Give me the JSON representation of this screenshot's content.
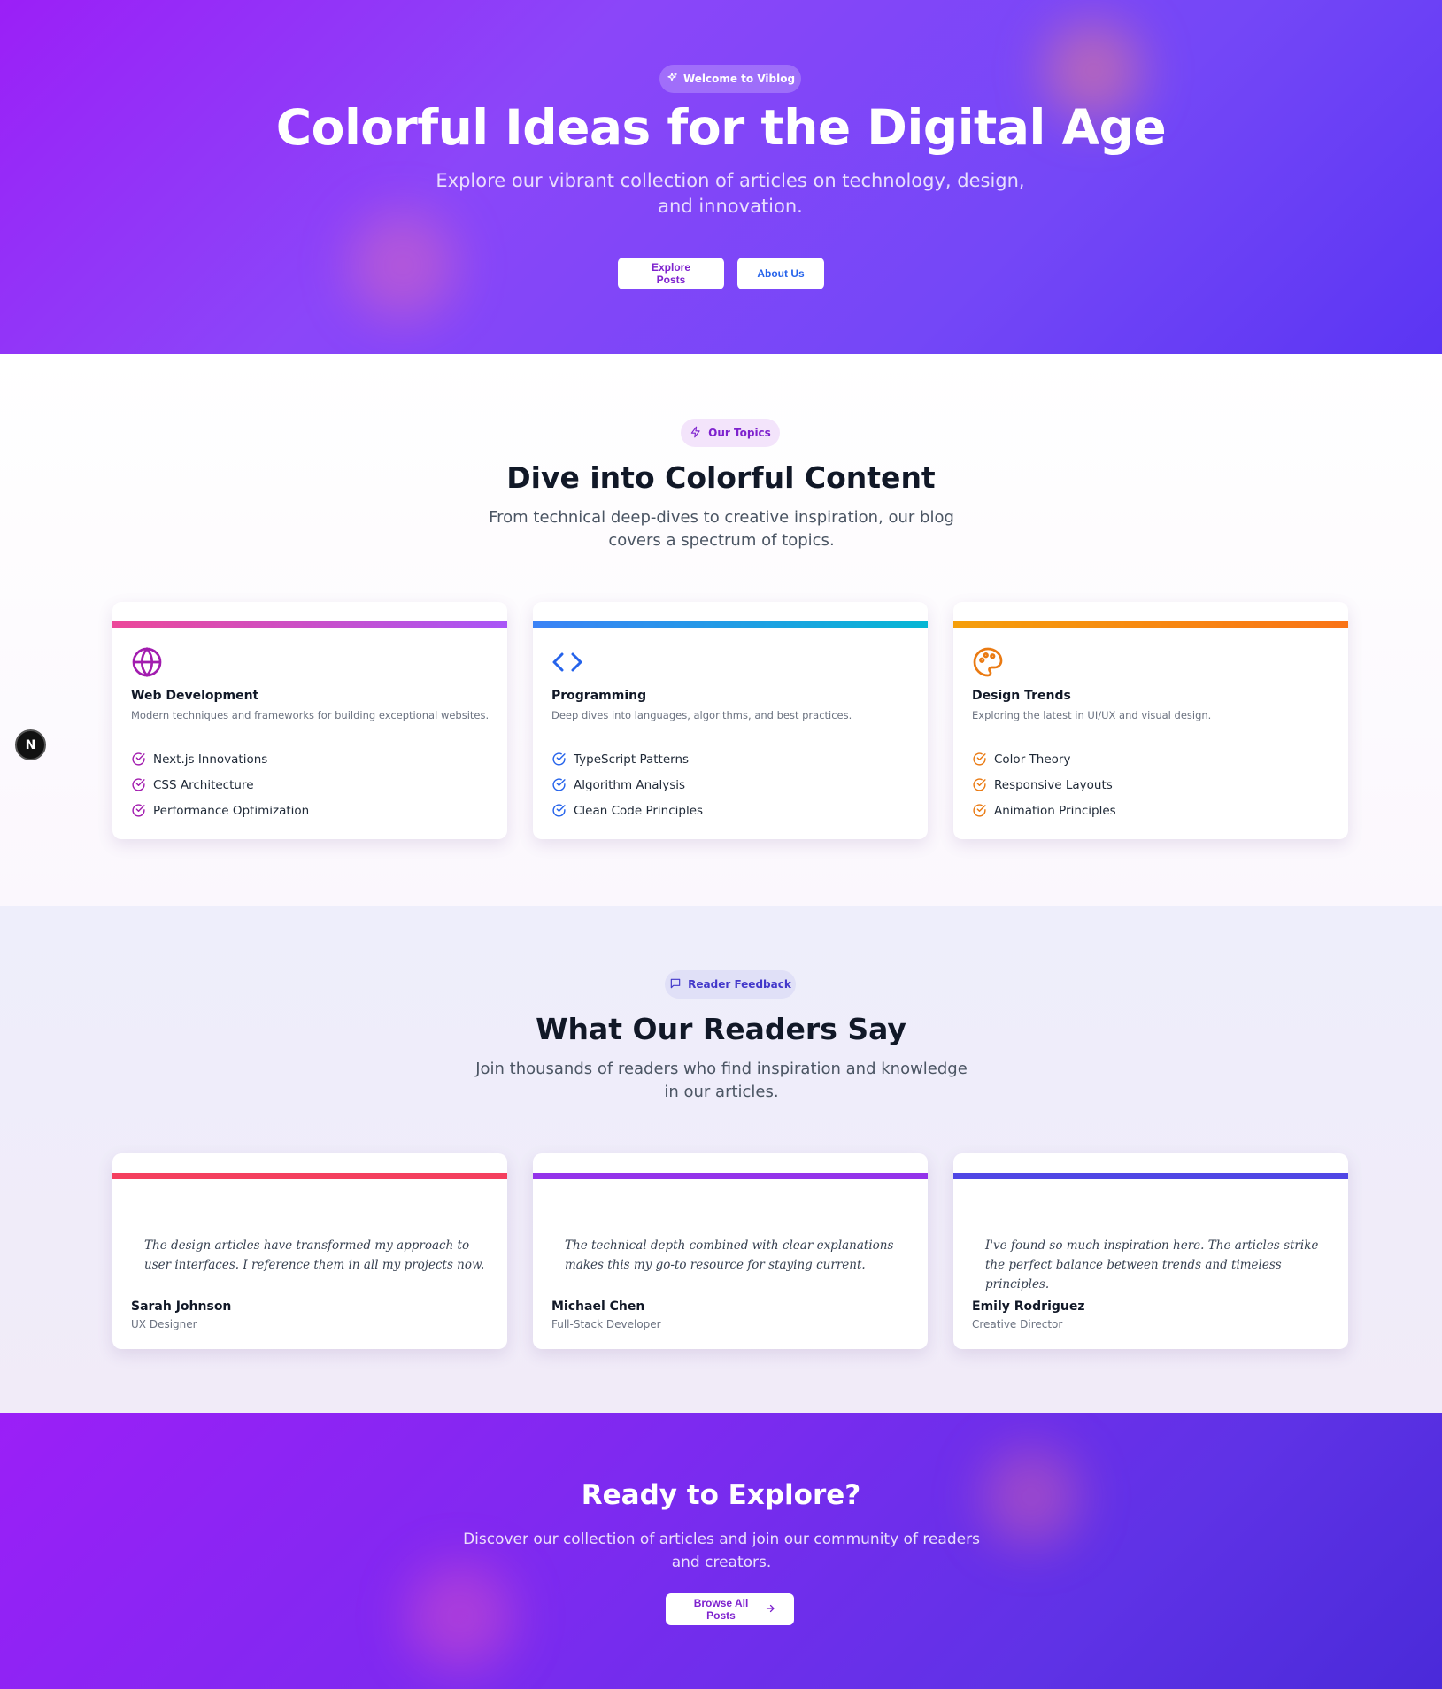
{
  "hero": {
    "badge_label": "Welcome to Viblog",
    "badge_icon": "sparkles-icon",
    "title": "Colorful Ideas for the Digital Age",
    "subtitle": "Explore our vibrant collection of articles on technology, design, and innovation.",
    "explore_label": "Explore Posts",
    "about_label": "About Us"
  },
  "topics": {
    "badge_label": "Our Topics",
    "badge_icon": "lightning-icon",
    "title": "Dive into Colorful Content",
    "subtitle": "From technical deep-dives to creative inspiration, our blog covers a spectrum of topics.",
    "cards": [
      {
        "icon": "globe-icon",
        "accent": "#a21caf",
        "title": "Web Development",
        "description": "Modern techniques and frameworks for building exceptional websites.",
        "items": [
          "Next.js Innovations",
          "CSS Architecture",
          "Performance Optimization"
        ]
      },
      {
        "icon": "code-icon",
        "accent": "#2563eb",
        "title": "Programming",
        "description": "Deep dives into languages, algorithms, and best practices.",
        "items": [
          "TypeScript Patterns",
          "Algorithm Analysis",
          "Clean Code Principles"
        ]
      },
      {
        "icon": "palette-icon",
        "accent": "#ea7a12",
        "title": "Design Trends",
        "description": "Exploring the latest in UI/UX and visual design.",
        "items": [
          "Color Theory",
          "Responsive Layouts",
          "Animation Principles"
        ]
      }
    ]
  },
  "testimonials": {
    "badge_label": "Reader Feedback",
    "badge_icon": "message-icon",
    "title": "What Our Readers Say",
    "subtitle": "Join thousands of readers who find inspiration and knowledge in our articles.",
    "items": [
      {
        "quote": "The design articles have transformed my approach to user interfaces. I reference them in all my projects now.",
        "name": "Sarah Johnson",
        "role": "UX Designer"
      },
      {
        "quote": "The technical depth combined with clear explanations makes this my go-to resource for staying current.",
        "name": "Michael Chen",
        "role": "Full-Stack Developer"
      },
      {
        "quote": "I've found so much inspiration here. The articles strike the perfect balance between trends and timeless principles.",
        "name": "Emily Rodriguez",
        "role": "Creative Director"
      }
    ]
  },
  "cta": {
    "title": "Ready to Explore?",
    "subtitle": "Discover our collection of articles and join our community of readers and creators.",
    "button_label": "Browse All Posts",
    "button_icon": "arrow-right-icon"
  },
  "dev_badge": {
    "label": "N",
    "icon": "nextjs-icon"
  },
  "colors": {
    "hero_gradient_start": "#9b1ff7",
    "hero_gradient_end": "#5b35f3",
    "accent_purple": "#7e22ce",
    "accent_blue": "#2563eb",
    "accent_orange": "#ea7a12"
  }
}
